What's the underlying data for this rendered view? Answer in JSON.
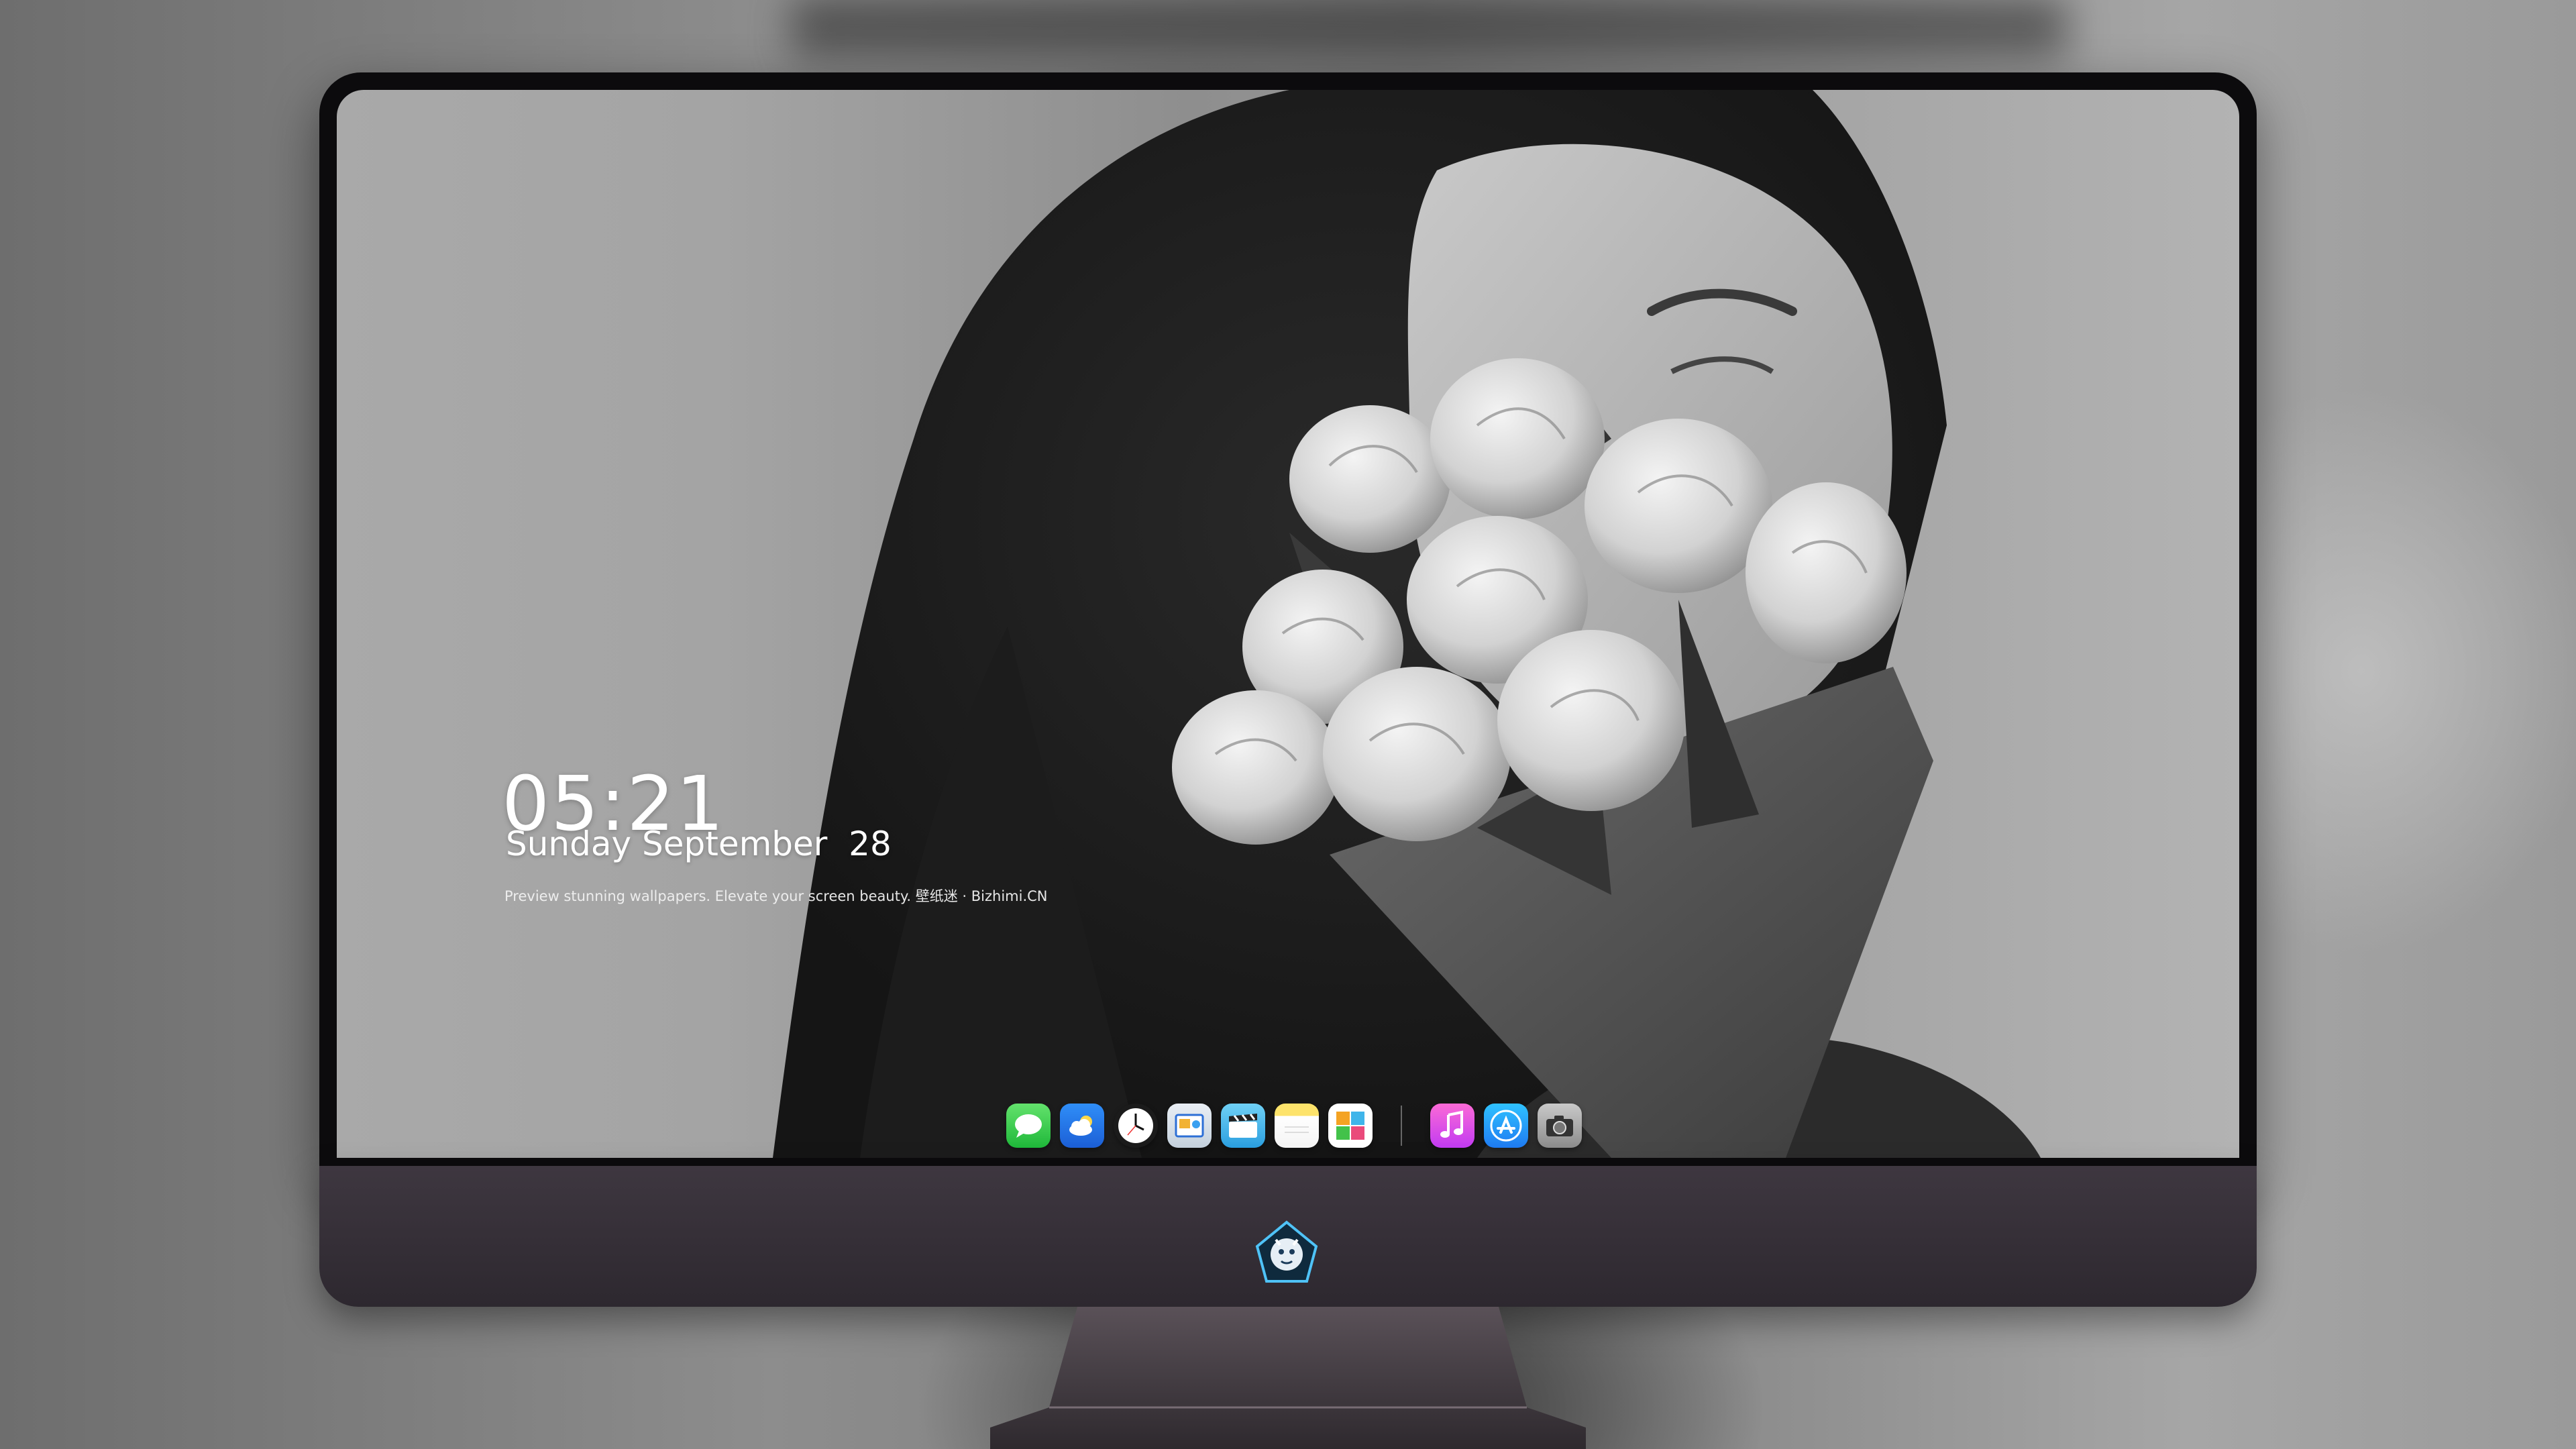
{
  "lock_screen": {
    "time": "05:21",
    "date": "Sunday September  28",
    "tagline": "Preview stunning wallpapers. Elevate your screen beauty. 壁纸迷 · Bizhimi.CN"
  },
  "dock": {
    "apps": [
      {
        "name": "messages-icon",
        "icon": "speech-bubble",
        "color": "#28c840"
      },
      {
        "name": "weather-icon",
        "icon": "cloud-sun",
        "color": "#2a7ff0"
      },
      {
        "name": "clock-icon",
        "icon": "clock",
        "color": "#1b1b1b"
      },
      {
        "name": "preview-icon",
        "icon": "image-viewer",
        "color": "#d5dde6"
      },
      {
        "name": "video-icon",
        "icon": "clapperboard",
        "color": "#3fb3ea"
      },
      {
        "name": "notes-icon",
        "icon": "notepad",
        "color": "#fde36b"
      },
      {
        "name": "photos-icon",
        "icon": "photo-grid",
        "color": "#ffffff"
      },
      {
        "name": "music-icon",
        "icon": "music-note",
        "color": "#e24ee6"
      },
      {
        "name": "app-store-icon",
        "icon": "app-store-a",
        "color": "#1f8ef5"
      },
      {
        "name": "camera-icon",
        "icon": "camera",
        "color": "#a8a8a8"
      }
    ]
  },
  "monitor": {
    "chin_logo": "dragon-mascot-logo",
    "colors": {
      "bezel": "#0c0b0d",
      "chin": "#3a343c",
      "stand": "#4a4248"
    }
  }
}
